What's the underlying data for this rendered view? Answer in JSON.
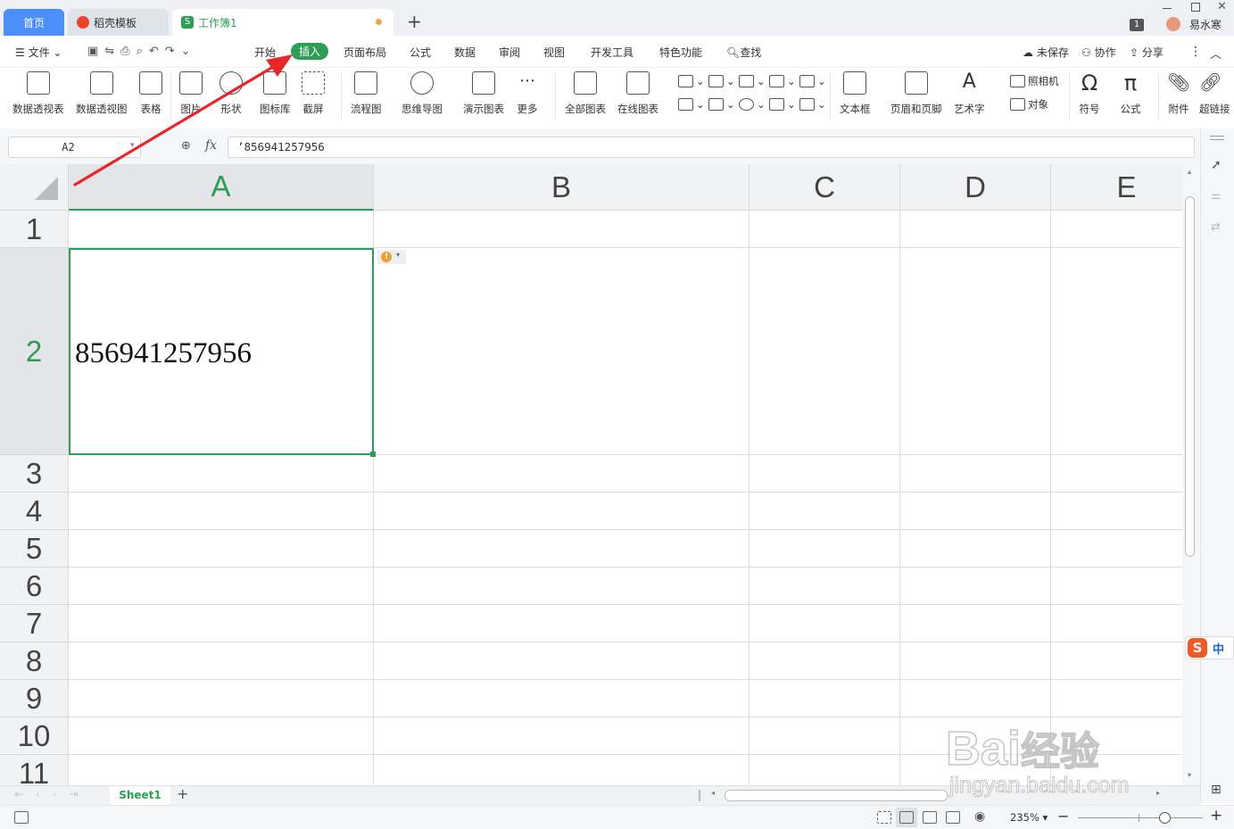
{
  "tabs": {
    "home": "首页",
    "templates": "稻壳模板",
    "workbook": "工作簿1",
    "new_tab": "+"
  },
  "titlebar": {
    "user_name": "易水寒",
    "badge": "1"
  },
  "menubar": {
    "file": "文件",
    "items": [
      "开始",
      "插入",
      "页面布局",
      "公式",
      "数据",
      "审阅",
      "视图",
      "开发工具",
      "特色功能"
    ],
    "search": "查找",
    "unsaved": "未保存",
    "collaborate": "协作",
    "share": "分享"
  },
  "ribbon": {
    "pivot_table": "数据透视表",
    "pivot_chart": "数据透视图",
    "table": "表格",
    "picture": "图片",
    "shapes": "形状",
    "icon_library": "图标库",
    "screenshot": "截屏",
    "flowchart": "流程图",
    "mind_map": "思维导图",
    "demo_chart": "演示图表",
    "more": "更多",
    "all_charts": "全部图表",
    "online_charts": "在线图表",
    "text_box": "文本框",
    "header_footer": "页眉和页脚",
    "word_art": "艺术字",
    "camera": "照相机",
    "object": "对象",
    "symbol": "符号",
    "formula": "公式",
    "attachment": "附件",
    "hyperlink": "超链接"
  },
  "formula_bar": {
    "cell_ref": "A2",
    "fx_label": "fx",
    "content": "’856941257956"
  },
  "grid": {
    "columns": [
      "A",
      "B",
      "C",
      "D",
      "E"
    ],
    "rows": [
      "1",
      "2",
      "3",
      "4",
      "5",
      "6",
      "7",
      "8",
      "9",
      "10",
      "11"
    ],
    "a2_value": "856941257956"
  },
  "sheets": {
    "active": "Sheet1",
    "add": "+"
  },
  "status": {
    "zoom": "235%"
  },
  "ime": {
    "label": "中"
  },
  "watermark": {
    "brand": "Bai",
    "brand2": "经验",
    "url": "jingyan.baidu.com"
  },
  "colors": {
    "accent_green": "#2e9d55",
    "tab_blue": "#4d8ff8",
    "arrow_red": "#e8262a"
  }
}
